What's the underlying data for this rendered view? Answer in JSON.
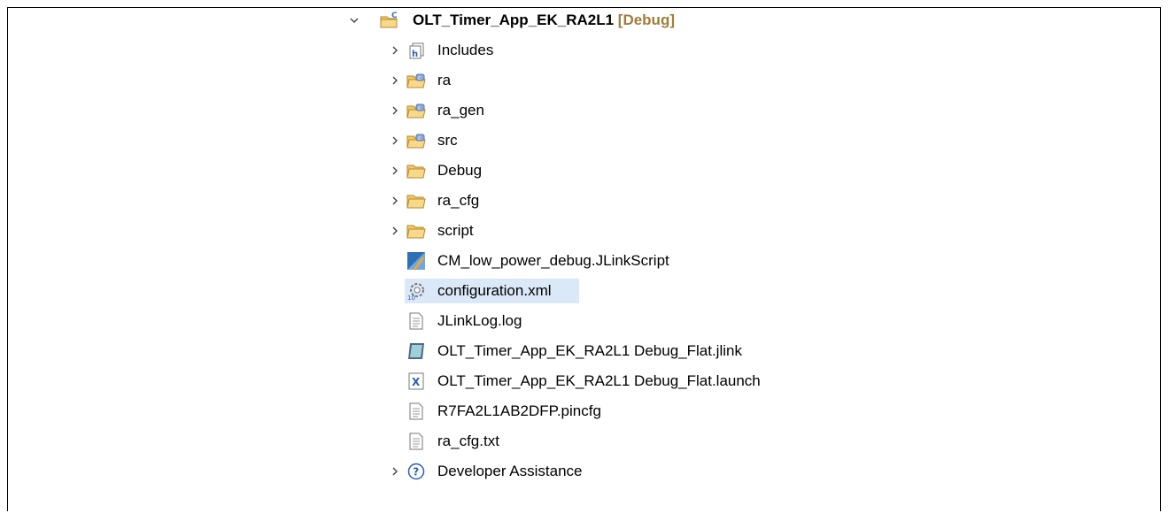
{
  "project": {
    "name": "OLT_Timer_App_EK_RA2L1",
    "decoration": "[Debug]",
    "icon": "c-project-icon",
    "expanded": true
  },
  "children": [
    {
      "label": "Includes",
      "icon": "includes-icon",
      "expandable": true
    },
    {
      "label": "ra",
      "icon": "source-folder-icon",
      "expandable": true
    },
    {
      "label": "ra_gen",
      "icon": "source-folder-icon",
      "expandable": true
    },
    {
      "label": "src",
      "icon": "source-folder-icon",
      "expandable": true
    },
    {
      "label": "Debug",
      "icon": "folder-icon",
      "expandable": true
    },
    {
      "label": "ra_cfg",
      "icon": "folder-icon",
      "expandable": true
    },
    {
      "label": "script",
      "icon": "folder-icon",
      "expandable": true
    },
    {
      "label": "CM_low_power_debug.JLinkScript",
      "icon": "jlink-script-icon",
      "expandable": false
    },
    {
      "label": "configuration.xml",
      "icon": "gear-file-icon",
      "expandable": false,
      "selected": true
    },
    {
      "label": "JLinkLog.log",
      "icon": "text-file-icon",
      "expandable": false
    },
    {
      "label": "OLT_Timer_App_EK_RA2L1 Debug_Flat.jlink",
      "icon": "jlink-file-icon",
      "expandable": false
    },
    {
      "label": "OLT_Timer_App_EK_RA2L1 Debug_Flat.launch",
      "icon": "launch-file-icon",
      "expandable": false
    },
    {
      "label": "R7FA2L1AB2DFP.pincfg",
      "icon": "text-file-icon",
      "expandable": false
    },
    {
      "label": "ra_cfg.txt",
      "icon": "text-file-icon",
      "expandable": false
    },
    {
      "label": "Developer Assistance",
      "icon": "help-icon",
      "expandable": true
    }
  ],
  "colors": {
    "selection": "#dbe8f7",
    "decoration": "#a07d3a",
    "folder": "#f3c866"
  }
}
